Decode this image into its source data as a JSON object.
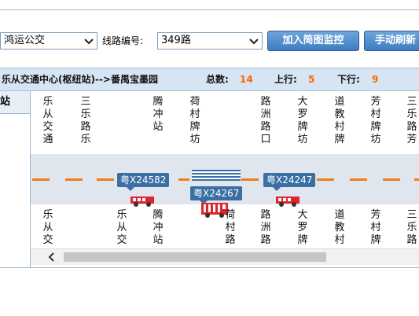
{
  "toolbar": {
    "company_value": "鸿运公交",
    "route_label": "线路编号:",
    "route_value": "349路",
    "add_monitor_label": "加入简图监控",
    "refresh_label": "手动刷新"
  },
  "info": {
    "route_name": "乐从交通中心(枢纽站)-->番禺宝墨园",
    "total_label": "总数:",
    "total_value": "14",
    "up_label": "上行:",
    "up_value": "5",
    "down_label": "下行:",
    "down_value": "9"
  },
  "sidebar": {
    "header": "站"
  },
  "stations_top": [
    "乐从交通",
    "三乐路乐",
    "",
    "",
    "腾冲站",
    "荷村牌坊",
    "",
    "路洲路口",
    "大罗牌坊",
    "道教村牌",
    "芳村牌坊",
    "三乐路芳"
  ],
  "stations_bottom": [
    "乐从交",
    "",
    "乐从交",
    "腾冲站",
    "",
    "荷村路",
    "",
    "路洲路",
    "大罗牌",
    "道教村",
    "芳村牌",
    "三乐路"
  ],
  "buses": [
    {
      "plate": "粤X24582"
    },
    {
      "plate": "粤X24267"
    },
    {
      "plate": "粤X24247"
    }
  ],
  "colors": {
    "route_line": "#f07d1c",
    "tag_bg": "#3a6ea5",
    "bus": "#e0242b",
    "number": "#ff6600"
  }
}
